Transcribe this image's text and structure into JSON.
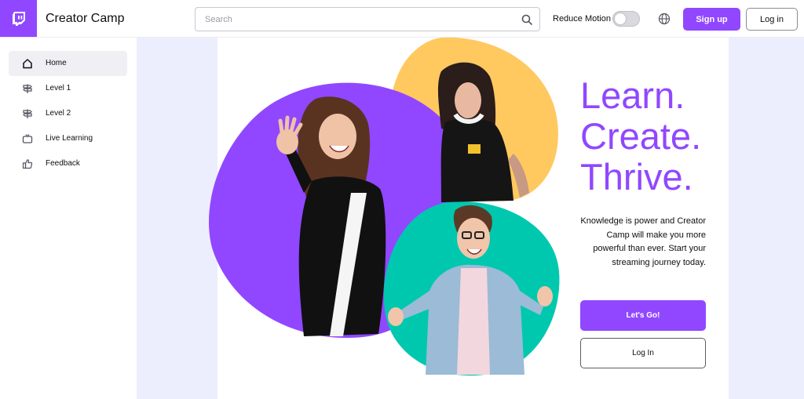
{
  "header": {
    "app_title": "Creator Camp",
    "search_placeholder": "Search",
    "reduce_motion_label": "Reduce Motion",
    "reduce_motion_on": false,
    "signup_label": "Sign up",
    "login_label": "Log in"
  },
  "sidebar": {
    "items": [
      {
        "label": "Home",
        "icon": "home-icon",
        "active": true
      },
      {
        "label": "Level 1",
        "icon": "signpost-icon",
        "active": false
      },
      {
        "label": "Level 2",
        "icon": "signpost-icon",
        "active": false
      },
      {
        "label": "Live Learning",
        "icon": "tv-icon",
        "active": false
      },
      {
        "label": "Feedback",
        "icon": "thumbs-up-icon",
        "active": false
      }
    ]
  },
  "hero": {
    "headline": [
      "Learn.",
      "Create.",
      "Thrive."
    ],
    "tagline": "Knowledge is power and Creator Camp will make you more powerful than ever. Start your streaming journey today.",
    "cta_label": "Let's Go!",
    "login_label": "Log In"
  },
  "colors": {
    "brand": "#9147ff",
    "yellow_blob": "#ffc960",
    "teal_blob": "#00c8af",
    "page_bg": "#eceefd"
  }
}
